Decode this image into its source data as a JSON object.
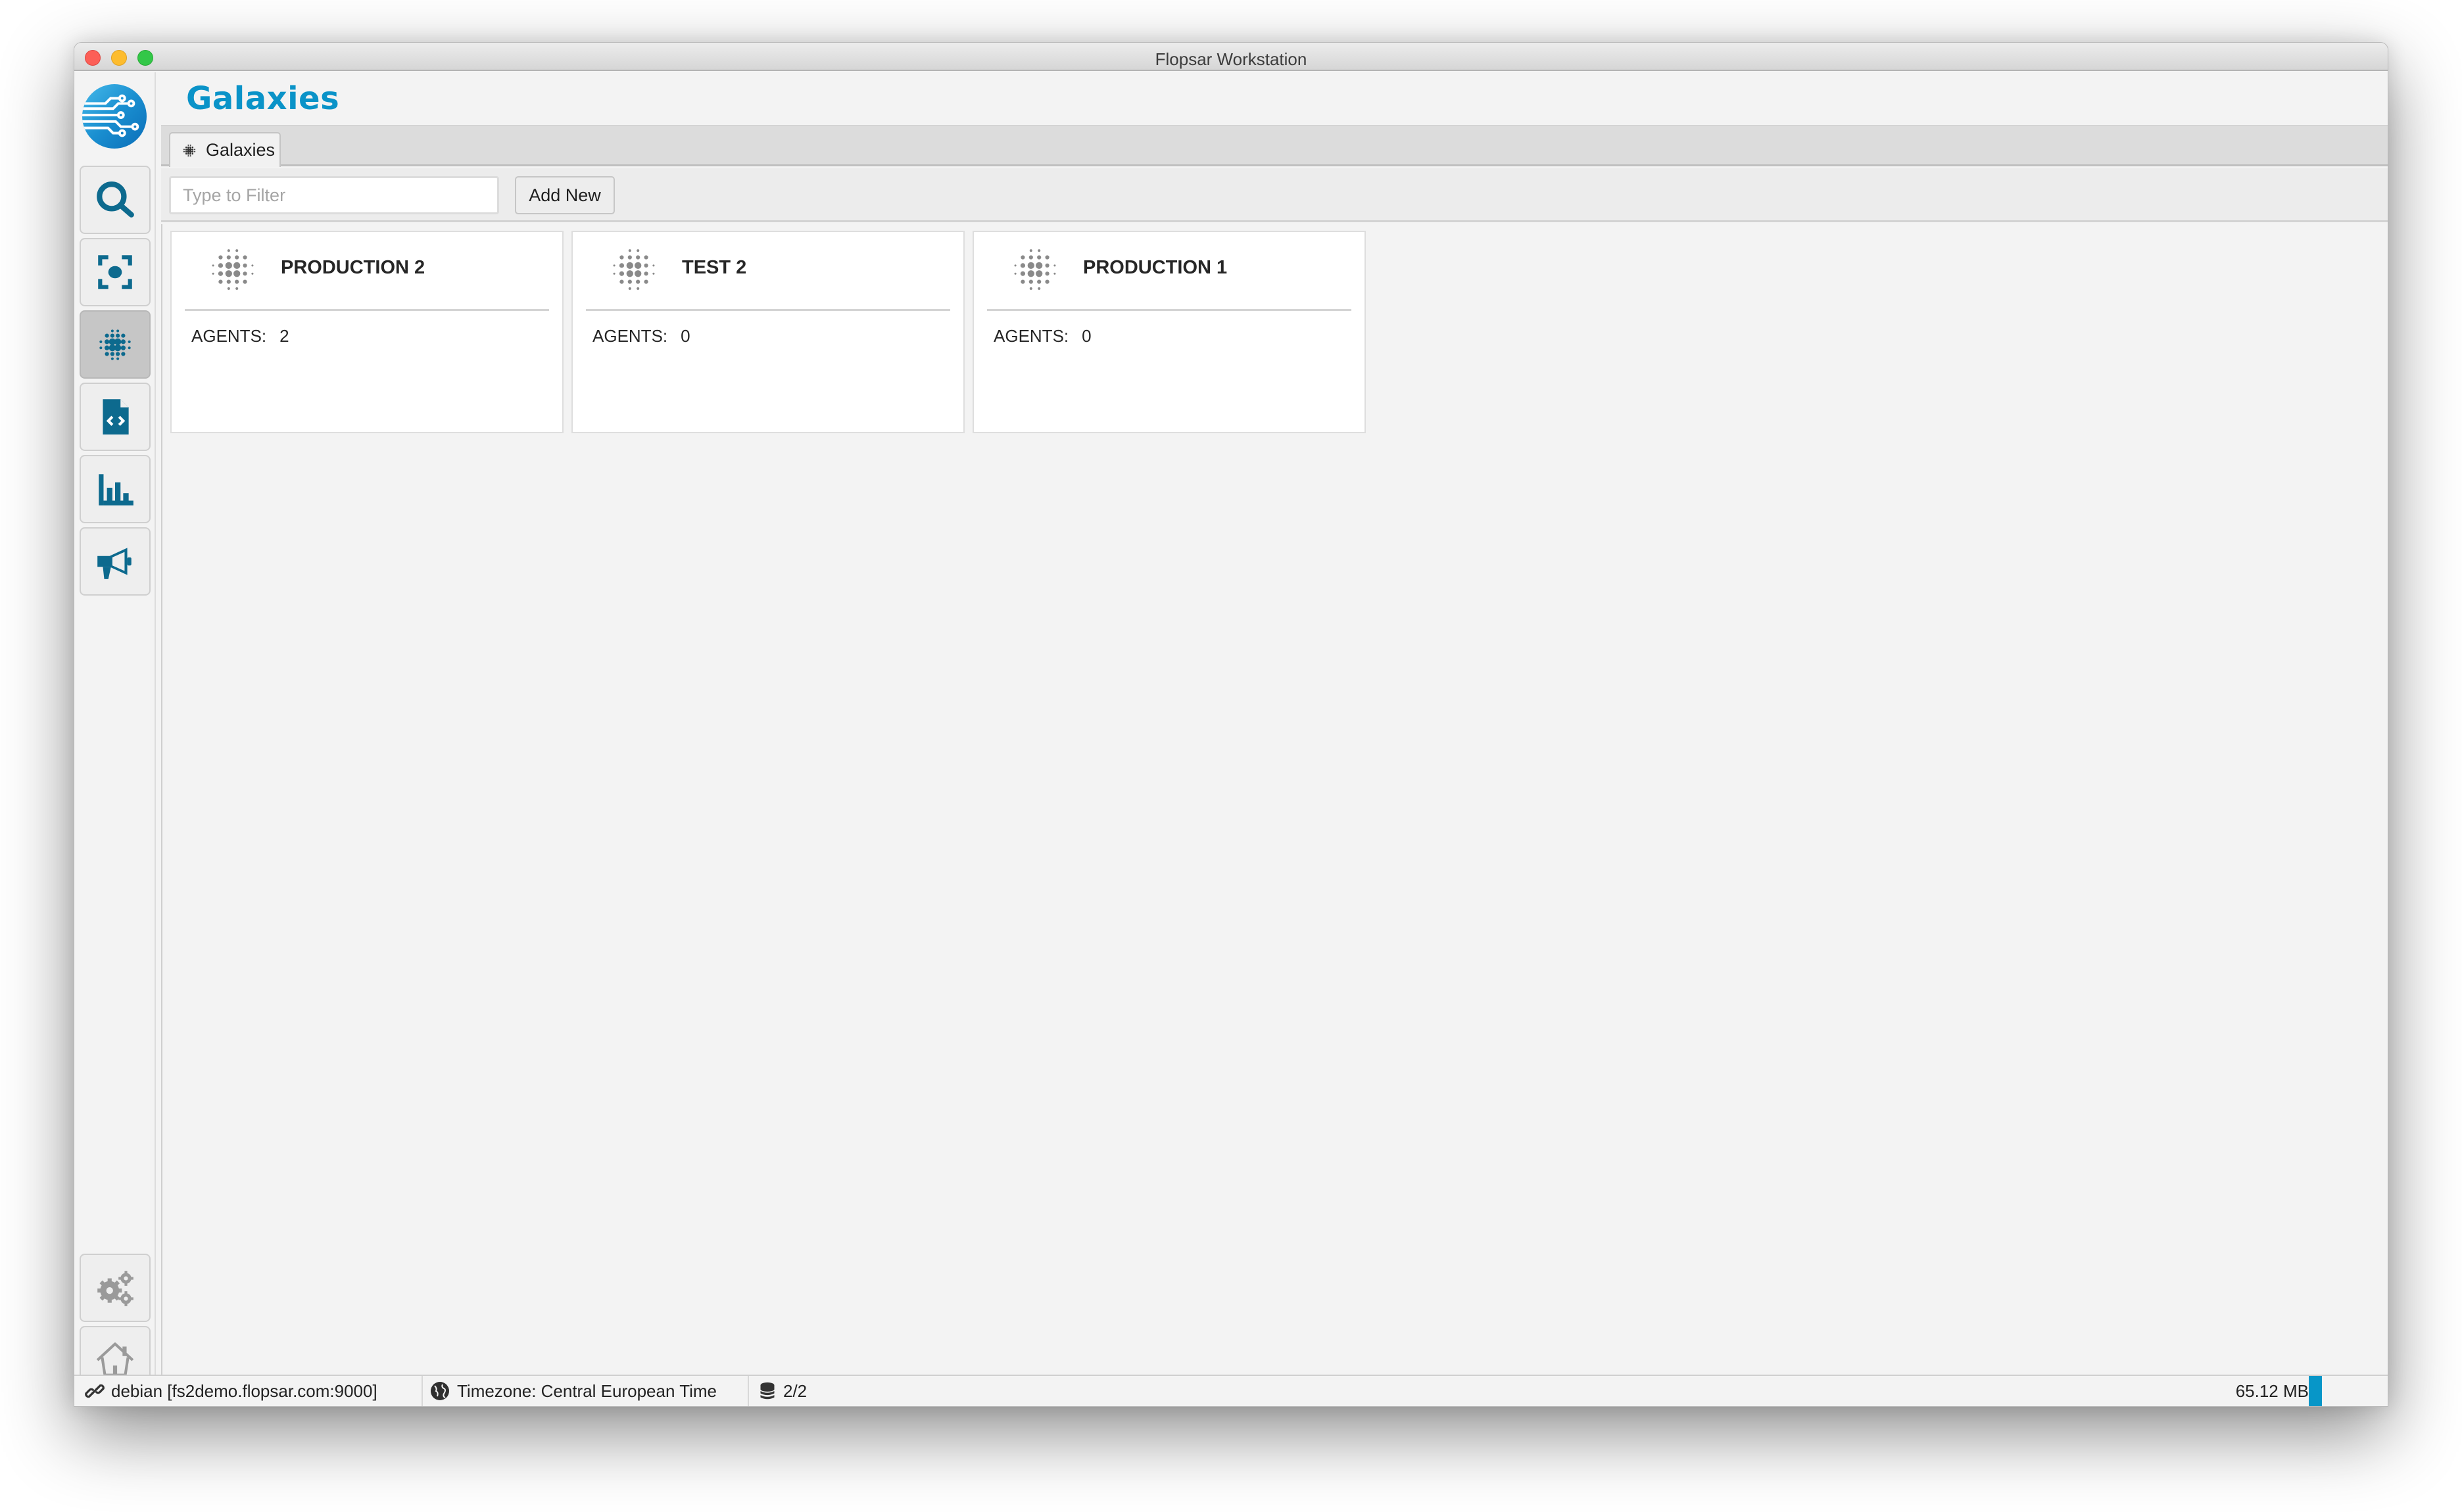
{
  "window": {
    "title": "Flopsar Workstation"
  },
  "sidebar": {
    "logo": "flopsar-logo",
    "nav": [
      {
        "icon": "search-icon",
        "label": "Search",
        "active": false
      },
      {
        "icon": "focus-capture-icon",
        "label": "Focus",
        "active": false
      },
      {
        "icon": "galaxy-dots-icon",
        "label": "Galaxies",
        "active": true
      },
      {
        "icon": "code-file-icon",
        "label": "Code File",
        "active": false
      },
      {
        "icon": "bar-chart-icon",
        "label": "Charts",
        "active": false
      },
      {
        "icon": "megaphone-icon",
        "label": "Announcements",
        "active": false
      }
    ],
    "bottom": [
      {
        "icon": "gears-icon",
        "label": "Settings"
      },
      {
        "icon": "home-icon",
        "label": "Home"
      }
    ]
  },
  "header": {
    "title": "Galaxies"
  },
  "tabs": [
    {
      "label": "Galaxies",
      "icon": "galaxy-dots-icon",
      "active": true
    }
  ],
  "toolbar": {
    "filter_placeholder": "Type to Filter",
    "filter_value": "",
    "add_label": "Add New"
  },
  "cards": [
    {
      "name": "PRODUCTION 2",
      "agents_label": "AGENTS:",
      "agents": "2"
    },
    {
      "name": "TEST 2",
      "agents_label": "AGENTS:",
      "agents": "0"
    },
    {
      "name": "PRODUCTION 1",
      "agents_label": "AGENTS:",
      "agents": "0"
    }
  ],
  "statusbar": {
    "connection": "debian [fs2demo.flopsar.com:9000]",
    "timezone": "Timezone: Central European Time",
    "databases": "2/2",
    "memory": "65.12 MB"
  },
  "colors": {
    "accent": "#0a93c8",
    "icon_blue": "#0d6a8e",
    "icon_gray": "#8a8a8a",
    "memory_bar": "#0796c8"
  }
}
